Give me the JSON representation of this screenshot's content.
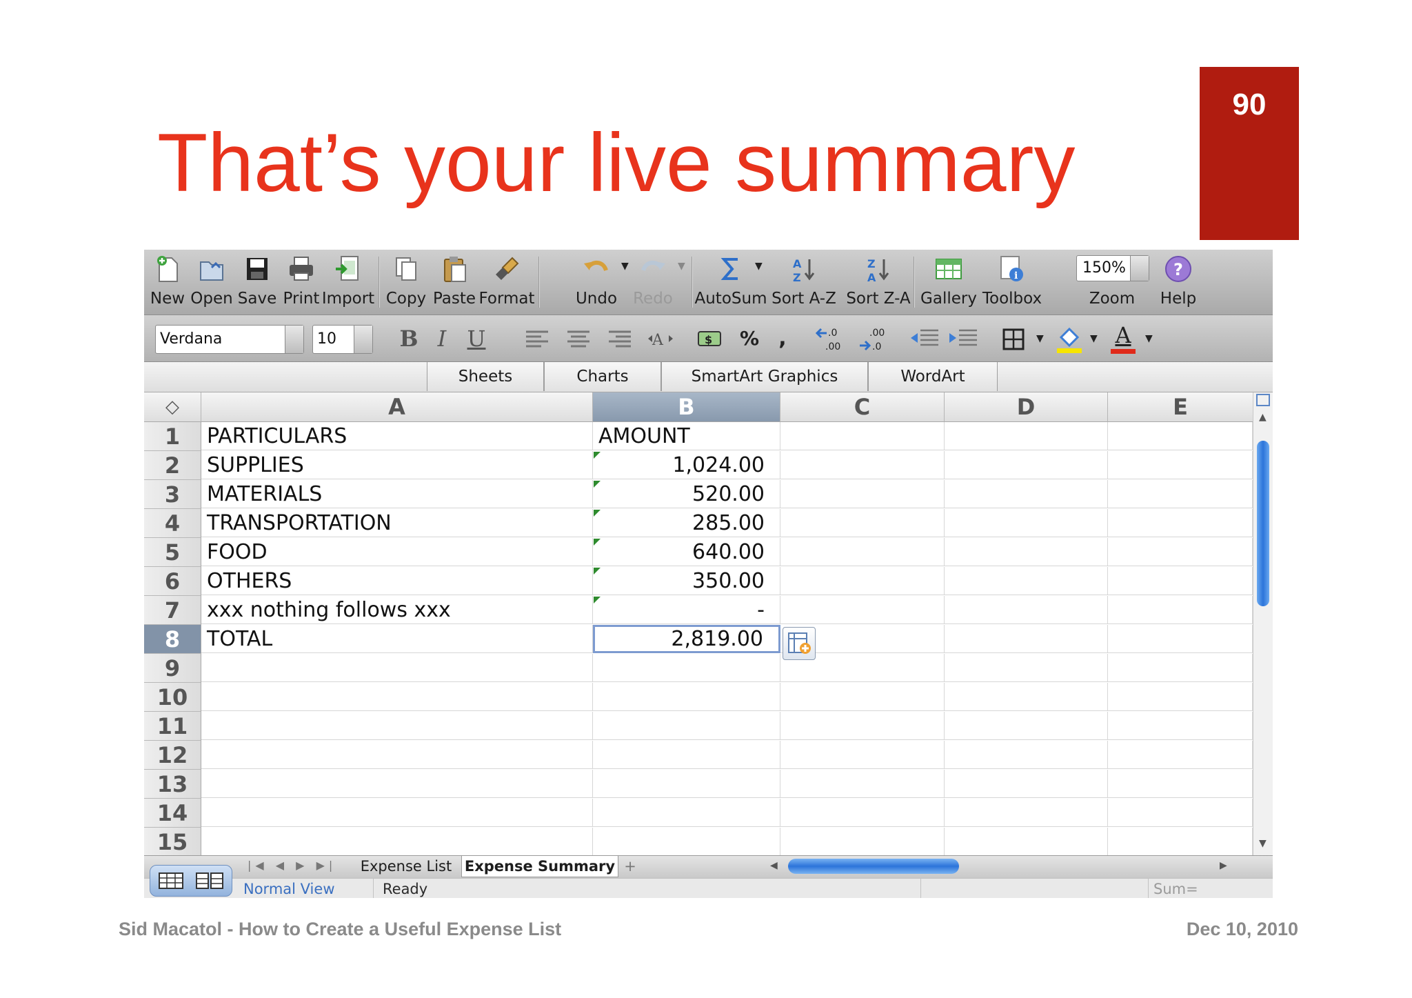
{
  "slide": {
    "title": "That’s your live summary",
    "page_number": "90",
    "footer_left": "Sid Macatol - How to Create a Useful Expense List",
    "footer_right": "Dec 10, 2010",
    "accent_color": "#e8331c",
    "badge_color": "#b01c10"
  },
  "toolbar": {
    "new": "New",
    "open": "Open",
    "save": "Save",
    "print": "Print",
    "import": "Import",
    "copy": "Copy",
    "paste": "Paste",
    "format": "Format",
    "undo": "Undo",
    "redo": "Redo",
    "autosum": "AutoSum",
    "sort_az": "Sort A-Z",
    "sort_za": "Sort Z-A",
    "gallery": "Gallery",
    "toolbox": "Toolbox",
    "zoom": "Zoom",
    "zoom_value": "150%",
    "help": "Help"
  },
  "formatting": {
    "font": "Verdana",
    "size": "10",
    "bold": "B",
    "italic": "I",
    "underline": "U",
    "percent": "%",
    "comma": ",",
    "font_color_glyph": "A"
  },
  "ribbon": {
    "tabs": [
      "Sheets",
      "Charts",
      "SmartArt Graphics",
      "WordArt"
    ]
  },
  "grid": {
    "columns": [
      "A",
      "B",
      "C",
      "D",
      "E"
    ],
    "selected_column": "B",
    "selected_row": "8",
    "rows": [
      {
        "n": "1",
        "a": "PARTICULARS",
        "b": "AMOUNT"
      },
      {
        "n": "2",
        "a": "SUPPLIES",
        "b": "1,024.00"
      },
      {
        "n": "3",
        "a": "MATERIALS",
        "b": "520.00"
      },
      {
        "n": "4",
        "a": "TRANSPORTATION",
        "b": "285.00"
      },
      {
        "n": "5",
        "a": "FOOD",
        "b": "640.00"
      },
      {
        "n": "6",
        "a": "OTHERS",
        "b": "350.00"
      },
      {
        "n": "7",
        "a": "xxx nothing follows xxx",
        "b": "-"
      },
      {
        "n": "8",
        "a": "TOTAL",
        "b": "2,819.00"
      },
      {
        "n": "9",
        "a": "",
        "b": ""
      },
      {
        "n": "10",
        "a": "",
        "b": ""
      },
      {
        "n": "11",
        "a": "",
        "b": ""
      },
      {
        "n": "12",
        "a": "",
        "b": ""
      },
      {
        "n": "13",
        "a": "",
        "b": ""
      },
      {
        "n": "14",
        "a": "",
        "b": ""
      },
      {
        "n": "15",
        "a": "",
        "b": ""
      }
    ]
  },
  "sheets": {
    "tabs": [
      "Expense List",
      "Expense Summary"
    ],
    "active": "Expense Summary",
    "add": "+"
  },
  "status": {
    "view": "Normal View",
    "state": "Ready",
    "sum": "Sum="
  }
}
